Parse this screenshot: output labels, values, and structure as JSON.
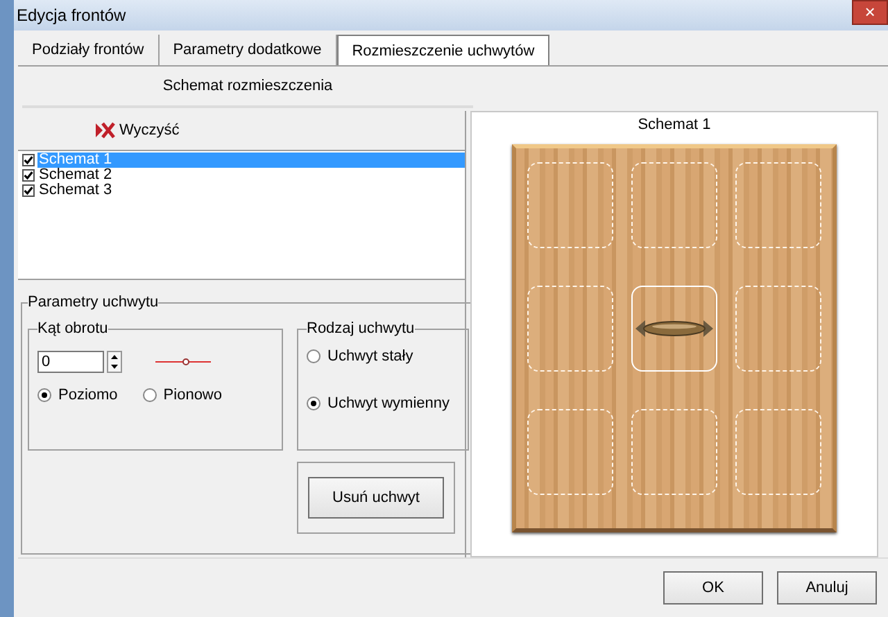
{
  "window": {
    "title": "Edycja frontów",
    "close": "×"
  },
  "tabs": [
    {
      "label": "Podziały frontów",
      "selected": false
    },
    {
      "label": "Parametry dodatkowe",
      "selected": false
    },
    {
      "label": "Rozmieszczenie uchwytów",
      "selected": true
    }
  ],
  "section_title": "Schemat rozmieszczenia",
  "toolbar": {
    "clear_label": "Wyczyść"
  },
  "schemes": [
    {
      "label": "Schemat 1",
      "checked": true,
      "selected": true
    },
    {
      "label": "Schemat 2",
      "checked": true,
      "selected": false
    },
    {
      "label": "Schemat 3",
      "checked": true,
      "selected": false
    }
  ],
  "handle_params": {
    "title": "Parametry uchwytu",
    "angle": {
      "title": "Kąt obrotu",
      "value": "0",
      "options": [
        {
          "label": "Poziomo",
          "selected": true
        },
        {
          "label": "Pionowo",
          "selected": false
        }
      ]
    },
    "type": {
      "title": "Rodzaj uchwytu",
      "options": [
        {
          "label": "Uchwyt stały",
          "selected": false
        },
        {
          "label": "Uchwyt wymienny",
          "selected": true
        }
      ]
    },
    "remove_button": "Usuń uchwyt"
  },
  "preview": {
    "title": "Schemat 1",
    "slots": [
      {
        "handle": false
      },
      {
        "handle": false
      },
      {
        "handle": false
      },
      {
        "handle": false
      },
      {
        "handle": true
      },
      {
        "handle": false
      },
      {
        "handle": false
      },
      {
        "handle": false
      },
      {
        "handle": false
      }
    ]
  },
  "buttons": [
    "OK",
    "Anuluj"
  ]
}
